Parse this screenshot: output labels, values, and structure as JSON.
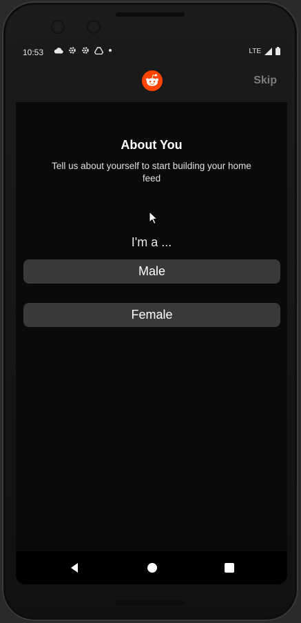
{
  "status_bar": {
    "time": "10:53",
    "network": "LTE"
  },
  "app_bar": {
    "skip_label": "Skip",
    "brand_color": "#ff4500"
  },
  "onboarding": {
    "title": "About You",
    "subtitle": "Tell us about yourself to start building your home feed",
    "prompt": "I'm a ...",
    "options": [
      {
        "label": "Male"
      },
      {
        "label": "Female"
      }
    ]
  }
}
